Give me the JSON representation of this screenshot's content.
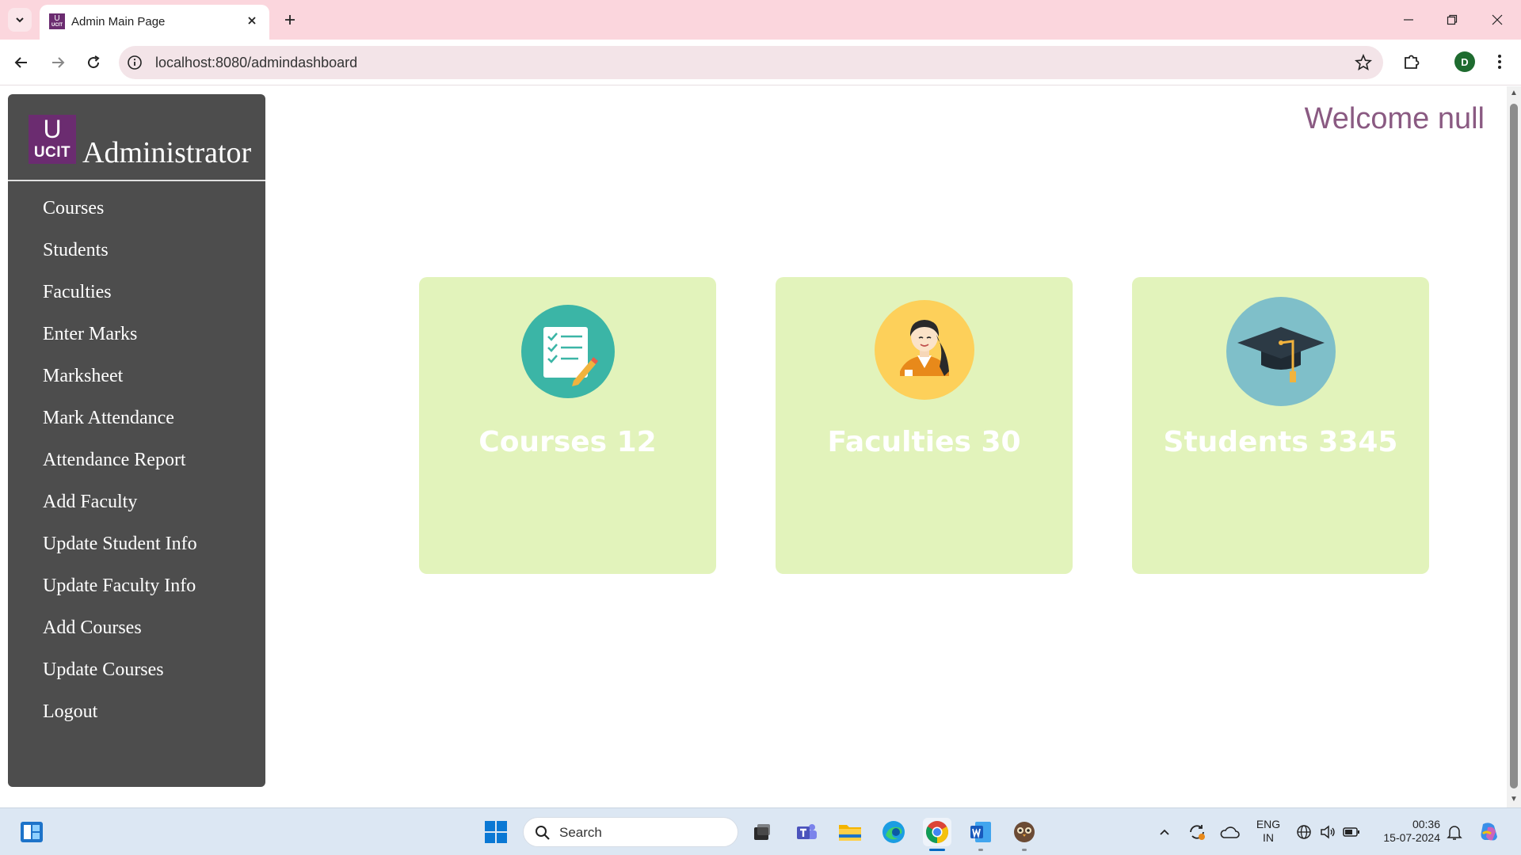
{
  "browser": {
    "tab_title": "Admin Main Page",
    "favicon_text": "UCIT",
    "url": "localhost:8080/admindashboard",
    "profile_initial": "D"
  },
  "sidebar": {
    "logo_top": "U",
    "logo_text": "UCIT",
    "title": "Administrator",
    "items": [
      {
        "label": "Courses"
      },
      {
        "label": "Students"
      },
      {
        "label": "Faculties"
      },
      {
        "label": "Enter Marks"
      },
      {
        "label": "Marksheet"
      },
      {
        "label": "Mark Attendance"
      },
      {
        "label": "Attendance Report"
      },
      {
        "label": "Add Faculty"
      },
      {
        "label": "Update Student Info"
      },
      {
        "label": "Update Faculty Info"
      },
      {
        "label": "Add Courses"
      },
      {
        "label": "Update Courses"
      },
      {
        "label": "Logout"
      }
    ]
  },
  "header": {
    "welcome": "Welcome null"
  },
  "cards": [
    {
      "label": "Courses 12",
      "icon": "checklist-icon",
      "icon_color": "#3bb5a6"
    },
    {
      "label": "Faculties 30",
      "icon": "faculty-avatar-icon",
      "icon_color": "#fdd05a"
    },
    {
      "label": "Students 3345",
      "icon": "graduation-cap-icon",
      "icon_color": "#7fbfc9"
    }
  ],
  "colors": {
    "sidebar_bg": "#4d4d4d",
    "card_bg": "#e2f3bb",
    "welcome_text": "#8a5a82",
    "brand": "#6b2c70"
  },
  "taskbar": {
    "search_placeholder": "Search",
    "lang_line1": "ENG",
    "lang_line2": "IN",
    "time": "00:36",
    "date": "15-07-2024"
  }
}
